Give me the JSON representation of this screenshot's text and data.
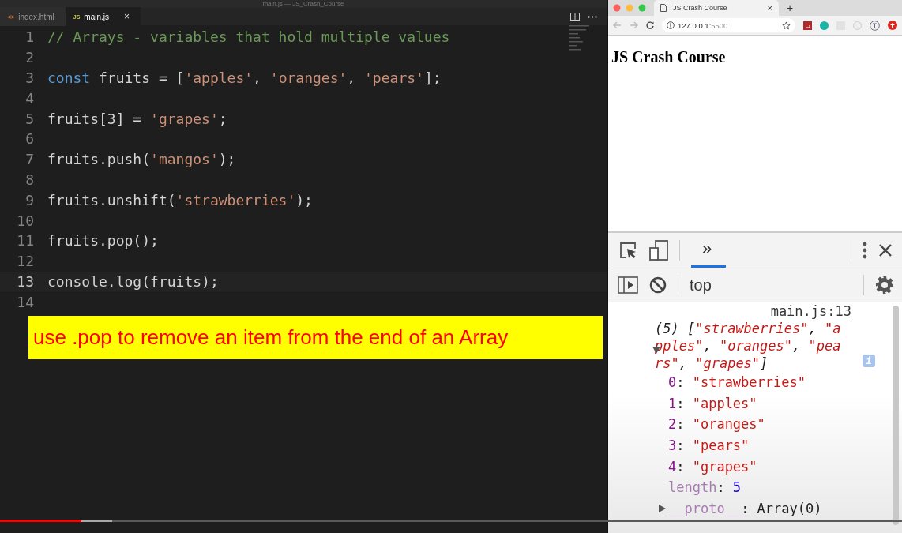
{
  "window": {
    "title": "main.js — JS_Crash_Course"
  },
  "editor": {
    "tabs": [
      {
        "label": "index.html",
        "badge": "<>",
        "selected": false
      },
      {
        "label": "main.js",
        "badge": "JS",
        "selected": true,
        "close": "×"
      }
    ],
    "lines": [
      {
        "number": "1",
        "tokens": [
          {
            "kind": "comment",
            "text": "// Arrays - variables that hold multiple values"
          }
        ]
      },
      {
        "number": "2"
      },
      {
        "number": "3",
        "tokens": [
          {
            "kind": "keyword",
            "text": "const"
          },
          {
            "kind": "plain",
            "text": " fruits = ["
          },
          {
            "kind": "string",
            "text": "'apples'"
          },
          {
            "kind": "plain",
            "text": ", "
          },
          {
            "kind": "string",
            "text": "'oranges'"
          },
          {
            "kind": "plain",
            "text": ", "
          },
          {
            "kind": "string",
            "text": "'pears'"
          },
          {
            "kind": "plain",
            "text": "];"
          }
        ]
      },
      {
        "number": "4"
      },
      {
        "number": "5",
        "tokens": [
          {
            "kind": "plain",
            "text": "fruits[3] = "
          },
          {
            "kind": "string",
            "text": "'grapes'"
          },
          {
            "kind": "plain",
            "text": ";"
          }
        ]
      },
      {
        "number": "6"
      },
      {
        "number": "7",
        "tokens": [
          {
            "kind": "plain",
            "text": "fruits.push("
          },
          {
            "kind": "string",
            "text": "'mangos'"
          },
          {
            "kind": "plain",
            "text": ");"
          }
        ]
      },
      {
        "number": "8"
      },
      {
        "number": "9",
        "tokens": [
          {
            "kind": "plain",
            "text": "fruits.unshift("
          },
          {
            "kind": "string",
            "text": "'strawberries'"
          },
          {
            "kind": "plain",
            "text": ");"
          }
        ]
      },
      {
        "number": "10"
      },
      {
        "number": "11",
        "tokens": [
          {
            "kind": "plain",
            "text": "fruits.pop();"
          }
        ]
      },
      {
        "number": "12"
      },
      {
        "number": "13",
        "tokens": [
          {
            "kind": "plain",
            "text": "console.log(fruits);"
          }
        ],
        "current": true
      },
      {
        "number": "14"
      }
    ]
  },
  "caption": "use .pop to remove an item from the end of an Array",
  "browser": {
    "tab": {
      "title": "JS Crash Course",
      "close": "×"
    },
    "new_tab": "+",
    "address": {
      "host": "127.0.0.1",
      "port": ":5500"
    },
    "page": {
      "heading": "JS Crash Course"
    },
    "devtools": {
      "more_tabs": "»",
      "context": "top",
      "console": {
        "source": "main.js:13",
        "summary": [
          {
            "kind": "plain",
            "text": "(5) ["
          },
          {
            "kind": "string",
            "text": "\"strawberries\""
          },
          {
            "kind": "plain",
            "text": ", "
          },
          {
            "kind": "string",
            "text": "\"apples\""
          },
          {
            "kind": "plain",
            "text": ", "
          },
          {
            "kind": "string",
            "text": "\"oranges\""
          },
          {
            "kind": "plain",
            "text": ", "
          },
          {
            "kind": "string",
            "text": "\"pears\""
          },
          {
            "kind": "plain",
            "text": ", "
          },
          {
            "kind": "string",
            "text": "\"grapes\""
          },
          {
            "kind": "plain",
            "text": "]"
          }
        ],
        "info": "i",
        "entries": [
          {
            "kind": "item",
            "key": "0",
            "sep": ":",
            "value": "\"strawberries\""
          },
          {
            "kind": "item",
            "key": "1",
            "sep": ":",
            "value": "\"apples\""
          },
          {
            "kind": "item",
            "key": "2",
            "sep": ":",
            "value": "\"oranges\""
          },
          {
            "kind": "item",
            "key": "3",
            "sep": ":",
            "value": "\"pears\""
          },
          {
            "kind": "item",
            "key": "4",
            "sep": ":",
            "value": "\"grapes\""
          },
          {
            "kind": "length",
            "key": "length",
            "sep": ":",
            "value": "5"
          },
          {
            "kind": "proto",
            "key": "__proto__",
            "sep": ":",
            "value": "Array(0)",
            "expanded": false
          }
        ]
      }
    }
  },
  "player": {
    "progress": {
      "level": 0.09
    },
    "buffer": {
      "level": 0.124
    }
  }
}
